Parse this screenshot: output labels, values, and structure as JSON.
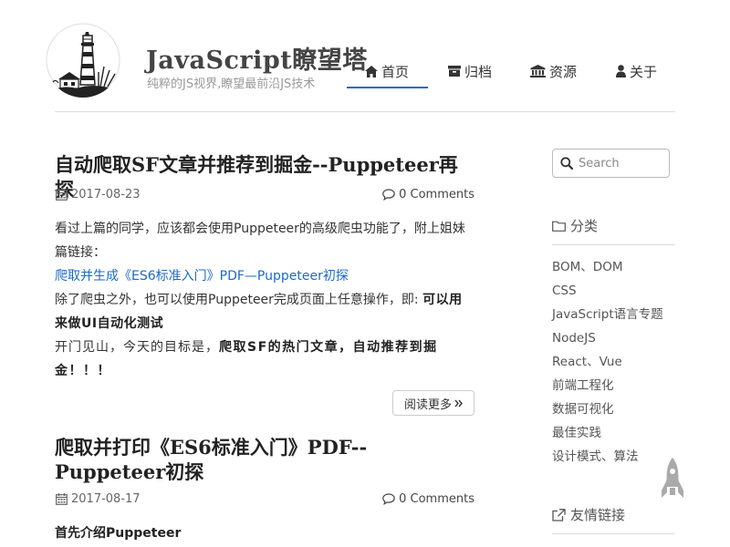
{
  "site": {
    "title": "JavaScript瞭望塔",
    "subtitle": "纯粹的JS视界,瞭望最前沿JS技术"
  },
  "nav": {
    "items": [
      {
        "label": "首页",
        "icon": "home-icon",
        "active": true
      },
      {
        "label": "归档",
        "icon": "archive-icon"
      },
      {
        "label": "资源",
        "icon": "bank-icon"
      },
      {
        "label": "关于",
        "icon": "user-icon"
      }
    ]
  },
  "posts": [
    {
      "title": "自动爬取SF文章并推荐到掘金--Puppeteer再探",
      "date": "2017-08-23",
      "comments": "0 Comments",
      "p1": "看过上篇的同学，应该都会使用Puppeteer的高级爬虫功能了，附上姐妹篇链接：",
      "link": "爬取并生成《ES6标准入门》PDF—Puppeteer初探",
      "p2_text": "除了爬虫之外，也可以使用Puppeteer完成页面上任意操作，即: ",
      "p2_bold": "可以用来做UI自动化测试",
      "p3_text": "开门见山，今天的目标是，",
      "p3_bold": "爬取SF的热门文章，自动推荐到掘金！！！",
      "read_more": "阅读更多"
    },
    {
      "title": "爬取并打印《ES6标准入门》PDF--Puppeteer初探",
      "date": "2017-08-17",
      "comments": "0 Comments",
      "intro_bold": "首先介绍Puppeteer"
    }
  ],
  "sidebar": {
    "search_placeholder": "Search",
    "categories_title": "分类",
    "categories": [
      "BOM、DOM",
      "CSS",
      "JavaScript语言专题",
      "NodeJS",
      "React、Vue",
      "前端工程化",
      "数据可视化",
      "最佳实践",
      "设计模式、算法"
    ],
    "links_title": "友情链接"
  },
  "colors": {
    "accent": "#1b6ac9",
    "rocket": "#aaaaaa"
  }
}
